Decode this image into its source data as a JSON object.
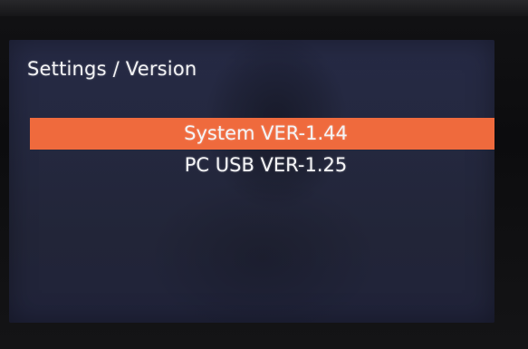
{
  "screen": {
    "title": "Settings / Version",
    "colors": {
      "background": "#24283f",
      "highlight": "#ef6a3d",
      "text": "#f4f4f6"
    },
    "menu": {
      "items": [
        {
          "label": "System VER-1.44",
          "selected": true
        },
        {
          "label": "PC USB VER-1.25",
          "selected": false
        }
      ]
    }
  }
}
